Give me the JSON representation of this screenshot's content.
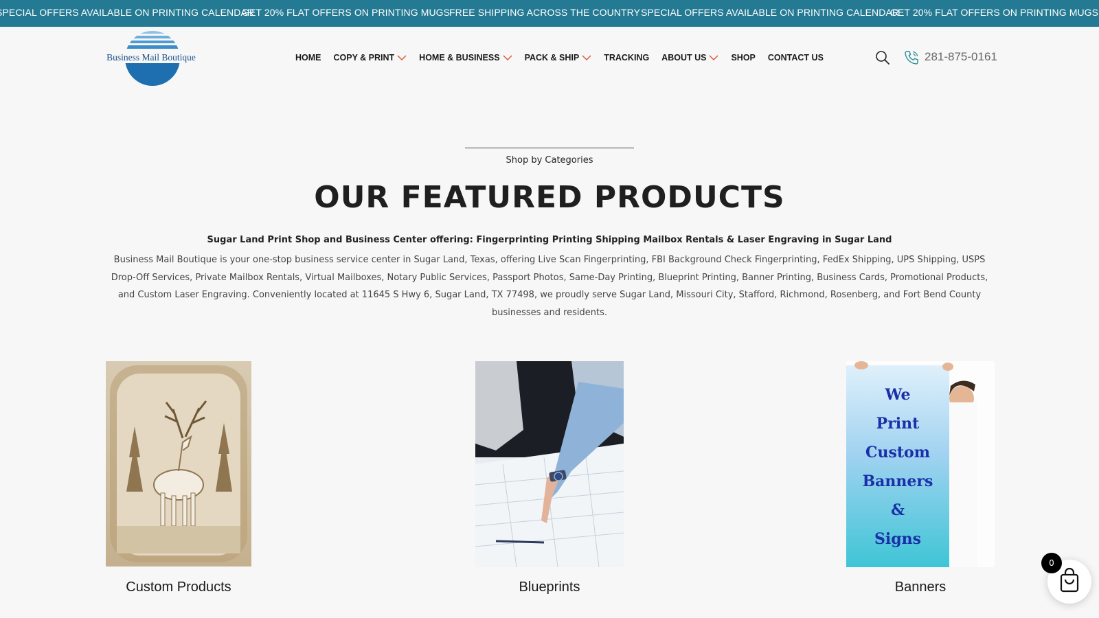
{
  "announcements": [
    "SPECIAL OFFERS AVAILABLE ON PRINTING CALENDAR",
    "GET 20% FLAT OFFERS ON PRINTING MUGS",
    "FREE SHIPPING ACROSS THE COUNTRY",
    "SPECIAL OFFERS AVAILABLE ON PRINTING CALENDAR",
    "GET 20% FLAT OFFERS ON PRINTING MUGS"
  ],
  "header": {
    "logo_text": "Business Mail Boutique",
    "nav": [
      {
        "label": "HOME",
        "dropdown": false
      },
      {
        "label": "COPY & PRINT",
        "dropdown": true
      },
      {
        "label": "HOME & BUSINESS",
        "dropdown": true
      },
      {
        "label": "PACK & SHIP",
        "dropdown": true
      },
      {
        "label": "TRACKING",
        "dropdown": false
      },
      {
        "label": "ABOUT US",
        "dropdown": true
      },
      {
        "label": "SHOP",
        "dropdown": false
      },
      {
        "label": "CONTACT US",
        "dropdown": false
      }
    ],
    "phone": "281-875-0161",
    "icons": {
      "search": "search-icon",
      "phone": "phone-icon"
    }
  },
  "section": {
    "eyebrow": "Shop by Categories",
    "title": "OUR FEATURED PRODUCTS",
    "subhead": "Sugar Land Print Shop and Business Center offering: Fingerprinting Printing Shipping Mailbox Rentals & Laser Engraving in Sugar Land",
    "description": "Business Mail Boutique is your one-stop business service center in Sugar Land, Texas, offering Live Scan Fingerprinting, FBI Background Check Fingerprinting, FedEx Shipping, UPS Shipping, USPS Drop-Off Services, Private Mailbox Rentals, Virtual Mailboxes, Notary Public Services, Passport Photos, Same-Day Printing, Blueprint Printing, Banner Printing, Business Cards, Promotional Products, and Custom Laser Engraving. Conveniently located at 11645 S Hwy 6, Sugar Land, TX 77498, we proudly serve Sugar Land, Missouri City, Stafford, Richmond, Rosenberg, and Fort Bend County businesses and residents."
  },
  "products": [
    {
      "name": "Custom Products"
    },
    {
      "name": "Blueprints"
    },
    {
      "name": "Banners",
      "banner_text": [
        "We",
        "Print",
        "Custom",
        "Banners",
        "&",
        "Signs"
      ]
    }
  ],
  "cart": {
    "count": "0"
  },
  "colors": {
    "topbar": "#247a93",
    "accent_chevron": "#e0573a",
    "logo_blue": "#1d6fb0"
  }
}
